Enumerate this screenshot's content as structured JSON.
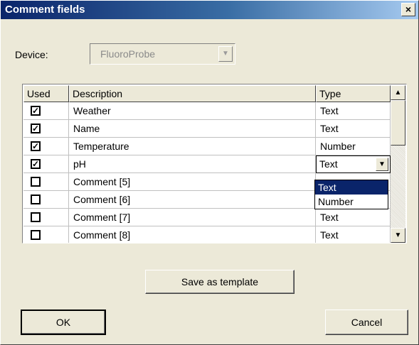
{
  "window": {
    "title": "Comment fields",
    "close_symbol": "×"
  },
  "device": {
    "label": "Device:",
    "value": "FluoroProbe",
    "arrow_symbol": "▼"
  },
  "table": {
    "columns": [
      "Used",
      "Description",
      "Type"
    ],
    "rows": [
      {
        "used": true,
        "description": "Weather",
        "type": "Text"
      },
      {
        "used": true,
        "description": "Name",
        "type": "Text"
      },
      {
        "used": true,
        "description": "Temperature",
        "type": "Number"
      },
      {
        "used": true,
        "description": "pH",
        "type": "Text"
      },
      {
        "used": false,
        "description": "Comment [5]",
        "type": ""
      },
      {
        "used": false,
        "description": "Comment [6]",
        "type": ""
      },
      {
        "used": false,
        "description": "Comment [7]",
        "type": "Text"
      },
      {
        "used": false,
        "description": "Comment [8]",
        "type": "Text"
      }
    ],
    "check_mark": "✓"
  },
  "type_dropdown": {
    "options": [
      "Text",
      "Number"
    ],
    "selected": "Text",
    "arrow_symbol": "▼"
  },
  "scrollbar": {
    "up_symbol": "▲",
    "down_symbol": "▼"
  },
  "buttons": {
    "save_template": "Save as template",
    "ok": "OK",
    "cancel": "Cancel"
  }
}
